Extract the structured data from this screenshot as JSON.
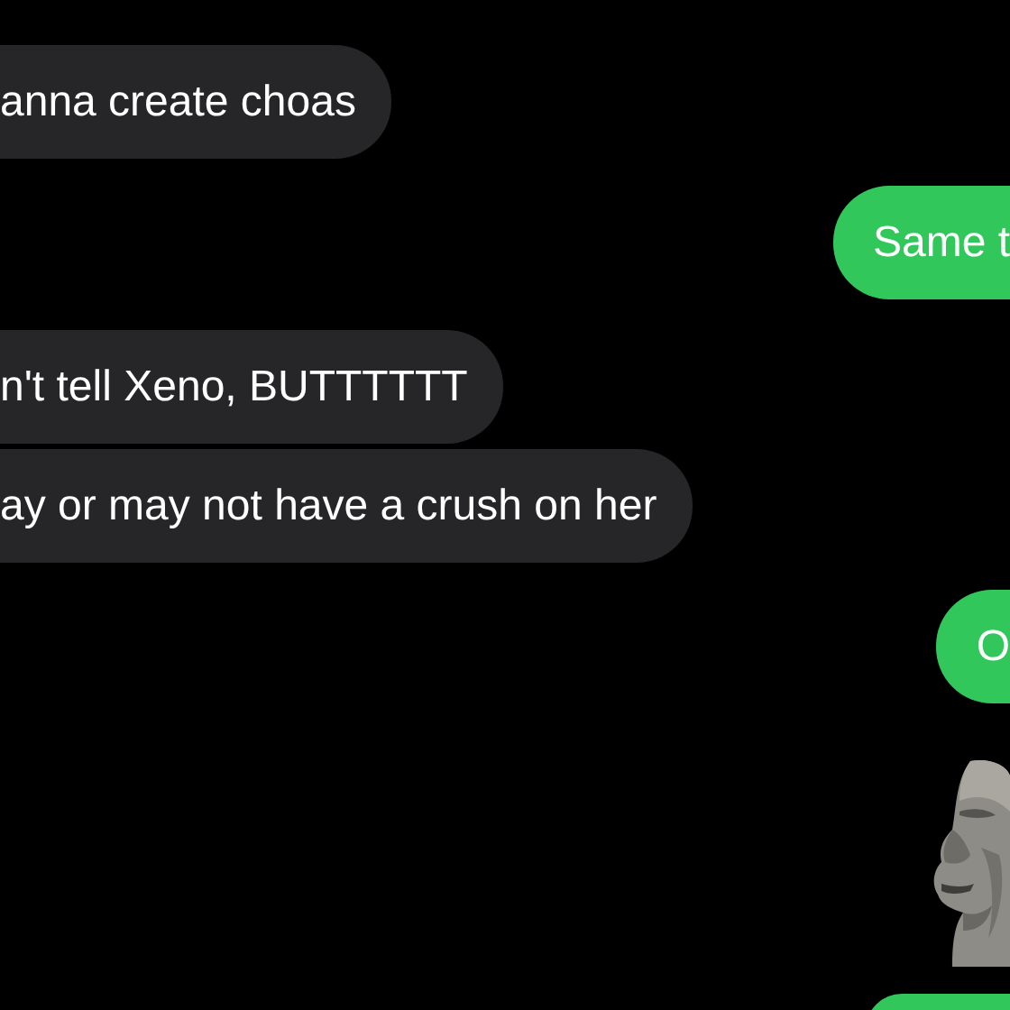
{
  "messages": [
    {
      "kind": "text",
      "outgoing": false,
      "text": "anna create choas"
    },
    {
      "kind": "text",
      "outgoing": true,
      "text": "Same t"
    },
    {
      "kind": "text",
      "outgoing": false,
      "text": "n't tell Xeno, BUTTTTTT"
    },
    {
      "kind": "text",
      "outgoing": false,
      "text": "ay or may not have a crush on her"
    },
    {
      "kind": "text",
      "outgoing": true,
      "text": "O"
    },
    {
      "kind": "sticker",
      "outgoing": true
    },
    {
      "kind": "edge",
      "outgoing": true
    }
  ]
}
